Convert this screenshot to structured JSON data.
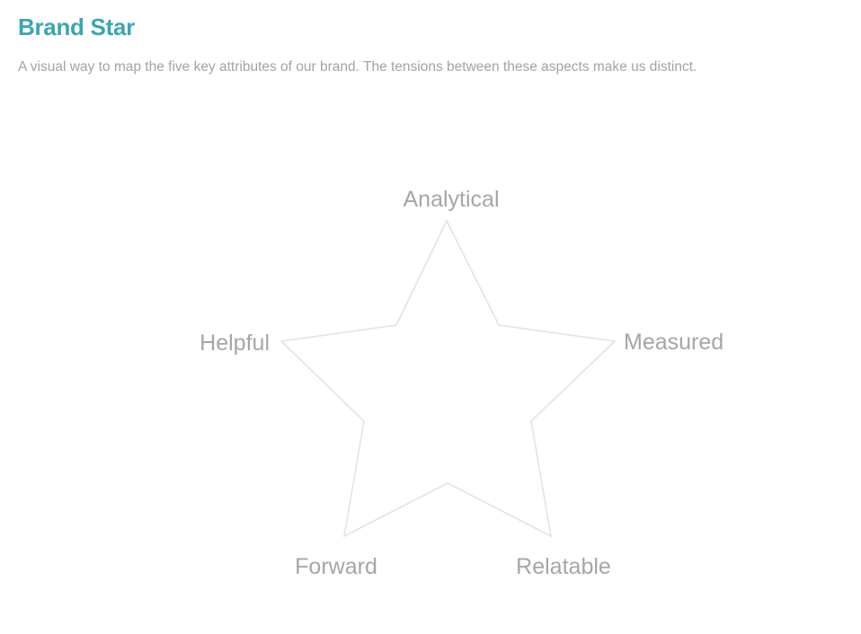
{
  "header": {
    "title": "Brand Star",
    "subtitle": "A visual way to map the five key attributes of our brand. The tensions between these aspects make us distinct."
  },
  "star": {
    "labels": {
      "top": "Analytical",
      "right": "Measured",
      "bottom_right": "Relatable",
      "bottom_left": "Forward",
      "left": "Helpful"
    }
  },
  "colors": {
    "title": "#3aa6b2",
    "subtitle": "#a3a3a3",
    "label": "#a6a6a6",
    "star_outline": "#e3e3e3"
  }
}
